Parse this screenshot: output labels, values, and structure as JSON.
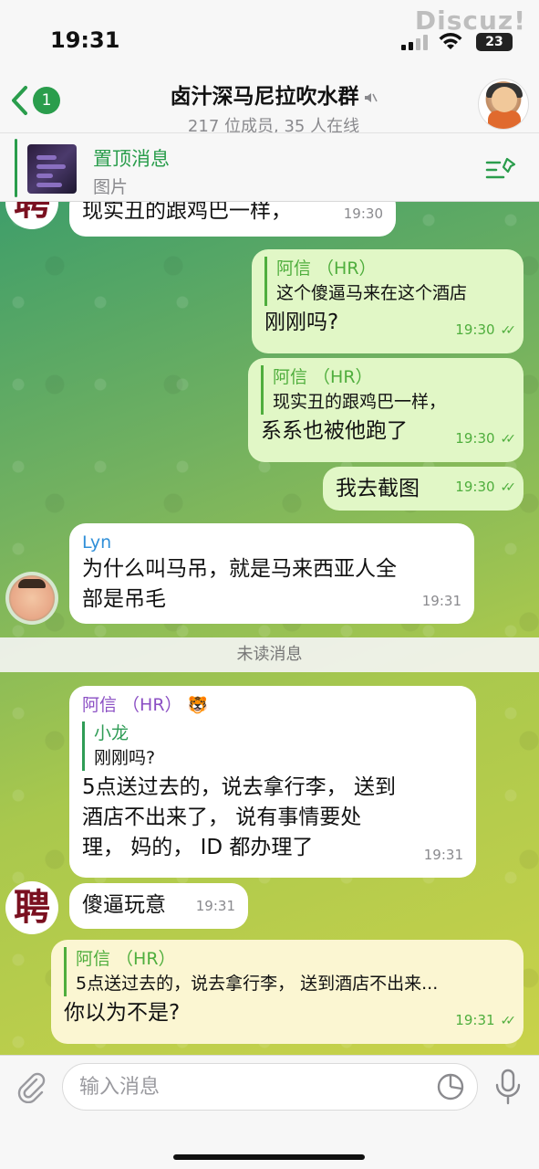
{
  "status": {
    "time": "19:31",
    "battery": "23",
    "watermark": "Discuz!"
  },
  "header": {
    "back_badge": "1",
    "title": "卤汁深马尼拉吹水群",
    "subtitle": "217 位成员, 35 人在线"
  },
  "pinned": {
    "title": "置顶消息",
    "subtitle": "图片"
  },
  "messages": [
    {
      "text": "现实丑的跟鸡巴一样，",
      "time": "19:30"
    },
    {
      "reply_name": "阿信 （HR）",
      "reply_text": "这个傻逼马来在这个酒店",
      "text": "刚刚吗?",
      "time": "19:30"
    },
    {
      "reply_name": "阿信 （HR）",
      "reply_text": "现实丑的跟鸡巴一样，",
      "text": "系系也被他跑了",
      "time": "19:30"
    },
    {
      "text": "我去截图",
      "time": "19:30"
    },
    {
      "sender": "Lyn",
      "text_line1": "为什么叫马吊，就是马来西亚人全",
      "text_line2": "部是吊毛",
      "time": "19:31"
    },
    {
      "sender": "阿信 （HR）",
      "reply_name": "小龙",
      "reply_text": "刚刚吗?",
      "text_line1": "5点送过去的，说去拿行李， 送到",
      "text_line2": "酒店不出来了， 说有事情要处",
      "text_line3": "理， 妈的， ID 都办理了",
      "time": "19:31"
    },
    {
      "text": "傻逼玩意",
      "time": "19:31"
    },
    {
      "reply_name": "阿信 （HR）",
      "reply_text": "5点送过去的，说去拿行李， 送到酒店不出来...",
      "text": "你以为不是?",
      "time": "19:31"
    }
  ],
  "avatars": {
    "calligraphy": "聘"
  },
  "unread_divider": "未读消息",
  "input": {
    "placeholder": "输入消息"
  },
  "colors": {
    "accent_green": "#2a9d4c",
    "outgoing_bubble": "#e1f7c6",
    "sender_purple": "#8b4fc4",
    "sender_blue": "#2f8fd8"
  }
}
